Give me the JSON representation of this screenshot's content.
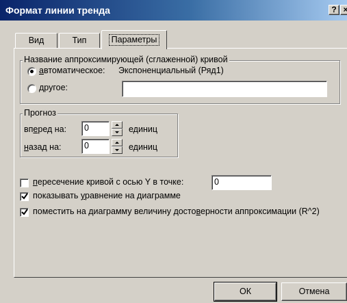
{
  "window": {
    "title": "Формат линии тренда",
    "help_label": "?",
    "close_label": "×"
  },
  "tabs": [
    {
      "label": "Вид"
    },
    {
      "label": "Тип"
    },
    {
      "label": "Параметры",
      "active": true
    }
  ],
  "curve_name": {
    "legend": "Название аппроксимирующей (сглаженной) кривой",
    "auto_label": "автоматическое:",
    "auto_value": "Экспоненциальный (Ряд1)",
    "auto_selected": true,
    "other_label": "другое:",
    "other_value": ""
  },
  "forecast": {
    "legend": "Прогноз",
    "forward_label": "вперед на:",
    "forward_value": "0",
    "backward_label": "назад на:",
    "backward_value": "0",
    "units_label": "единиц"
  },
  "options": {
    "intercept_label": "пересечение кривой с осью Y в точке:",
    "intercept_checked": false,
    "intercept_value": "0",
    "show_equation_label": "показывать уравнение на диаграмме",
    "show_equation_checked": true,
    "show_r2_label": "поместить на диаграмму величину достоверности аппроксимации (R^2)",
    "show_r2_checked": true
  },
  "buttons": {
    "ok_label": "ОК",
    "cancel_label": "Отмена"
  }
}
